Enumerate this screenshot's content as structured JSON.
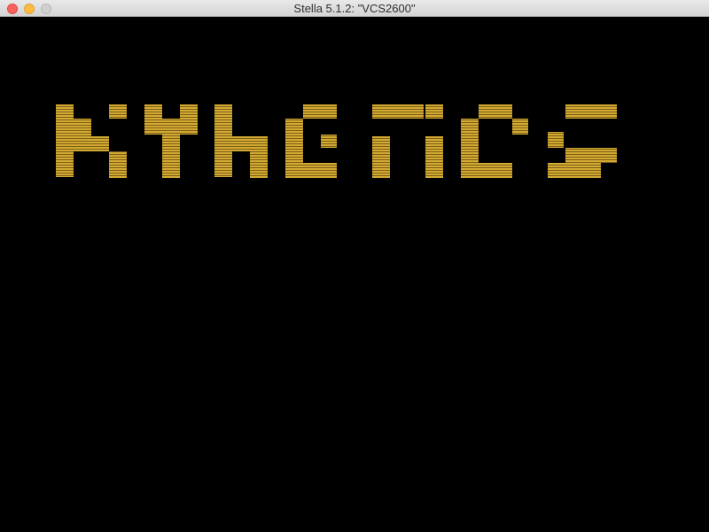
{
  "window": {
    "title": "Stella 5.1.2: \"VCS2600\""
  },
  "game": {
    "logo_text": "KYNETICS",
    "logo_color": "#c9a227",
    "background_color": "#000000"
  }
}
